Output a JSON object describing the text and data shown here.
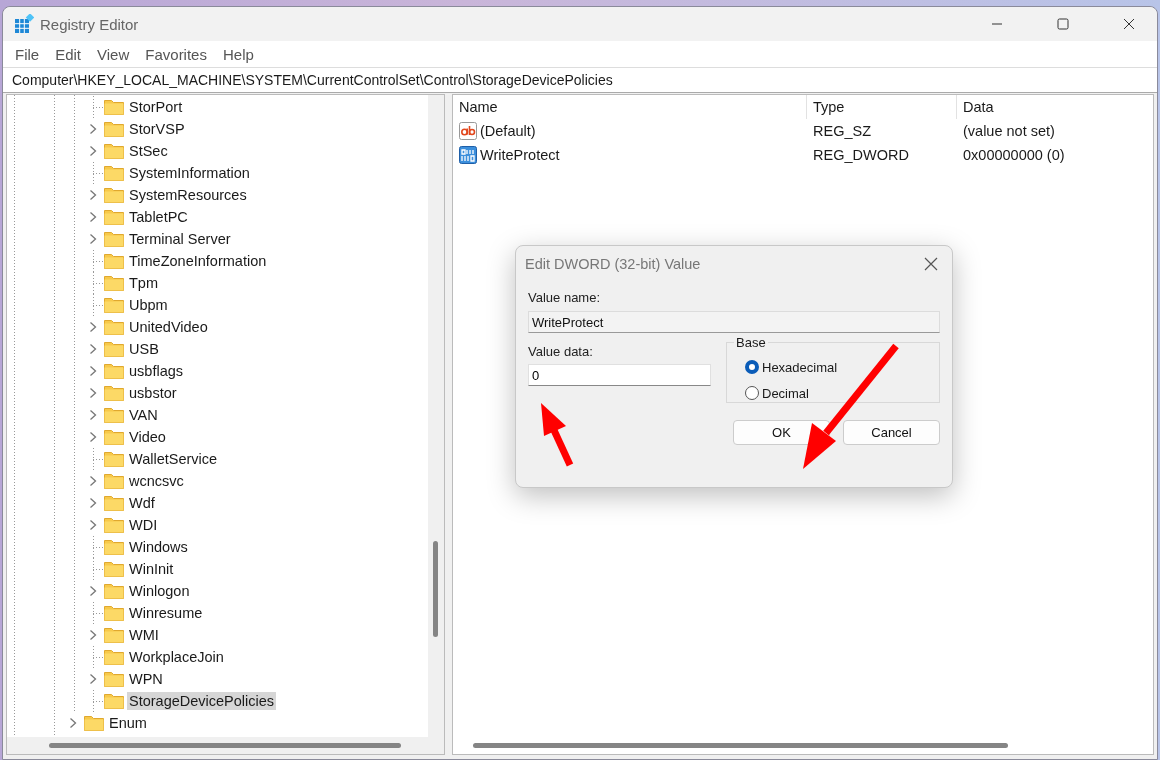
{
  "window": {
    "title": "Registry Editor"
  },
  "menu": [
    "File",
    "Edit",
    "View",
    "Favorites",
    "Help"
  ],
  "address": "Computer\\HKEY_LOCAL_MACHINE\\SYSTEM\\CurrentControlSet\\Control\\StorageDevicePolicies",
  "tree": {
    "items": [
      {
        "children": [
          {
            "label": "StorPort",
            "expandable": false,
            "selected": false
          },
          {
            "label": "StorVSP",
            "expandable": true,
            "selected": false
          },
          {
            "label": "StSec",
            "expandable": true,
            "selected": false
          },
          {
            "label": "SystemInformation",
            "expandable": false,
            "selected": false
          },
          {
            "label": "SystemResources",
            "expandable": true,
            "selected": false
          },
          {
            "label": "TabletPC",
            "expandable": true,
            "selected": false
          },
          {
            "label": "Terminal Server",
            "expandable": true,
            "selected": false
          },
          {
            "label": "TimeZoneInformation",
            "expandable": false,
            "selected": false
          },
          {
            "label": "Tpm",
            "expandable": false,
            "selected": false
          },
          {
            "label": "Ubpm",
            "expandable": false,
            "selected": false
          },
          {
            "label": "UnitedVideo",
            "expandable": true,
            "selected": false
          },
          {
            "label": "USB",
            "expandable": true,
            "selected": false
          },
          {
            "label": "usbflags",
            "expandable": true,
            "selected": false
          },
          {
            "label": "usbstor",
            "expandable": true,
            "selected": false
          },
          {
            "label": "VAN",
            "expandable": true,
            "selected": false
          },
          {
            "label": "Video",
            "expandable": true,
            "selected": false
          },
          {
            "label": "WalletService",
            "expandable": false,
            "selected": false
          },
          {
            "label": "wcncsvc",
            "expandable": true,
            "selected": false
          },
          {
            "label": "Wdf",
            "expandable": true,
            "selected": false
          },
          {
            "label": "WDI",
            "expandable": true,
            "selected": false
          },
          {
            "label": "Windows",
            "expandable": false,
            "selected": false
          },
          {
            "label": "WinInit",
            "expandable": false,
            "selected": false
          },
          {
            "label": "Winlogon",
            "expandable": true,
            "selected": false
          },
          {
            "label": "Winresume",
            "expandable": false,
            "selected": false
          },
          {
            "label": "WMI",
            "expandable": true,
            "selected": false
          },
          {
            "label": "WorkplaceJoin",
            "expandable": false,
            "selected": false
          },
          {
            "label": "WPN",
            "expandable": true,
            "selected": false
          },
          {
            "label": "StorageDevicePolicies",
            "expandable": false,
            "selected": true
          }
        ]
      },
      {
        "label": "Enum",
        "expandable": true,
        "selected": false
      }
    ]
  },
  "values": {
    "columns": [
      "Name",
      "Type",
      "Data"
    ],
    "rows": [
      {
        "kind": "string",
        "name": "(Default)",
        "type": "REG_SZ",
        "data": "(value not set)"
      },
      {
        "kind": "binary",
        "name": "WriteProtect",
        "type": "REG_DWORD",
        "data": "0x00000000 (0)"
      }
    ]
  },
  "dialog": {
    "title": "Edit DWORD (32-bit) Value",
    "value_name_label": "Value name:",
    "value_name": "WriteProtect",
    "value_data_label": "Value data:",
    "value_data": "0",
    "base_label": "Base",
    "base_options": [
      {
        "label": "Hexadecimal",
        "selected": true
      },
      {
        "label": "Decimal",
        "selected": false
      }
    ],
    "buttons": [
      "OK",
      "Cancel"
    ]
  }
}
